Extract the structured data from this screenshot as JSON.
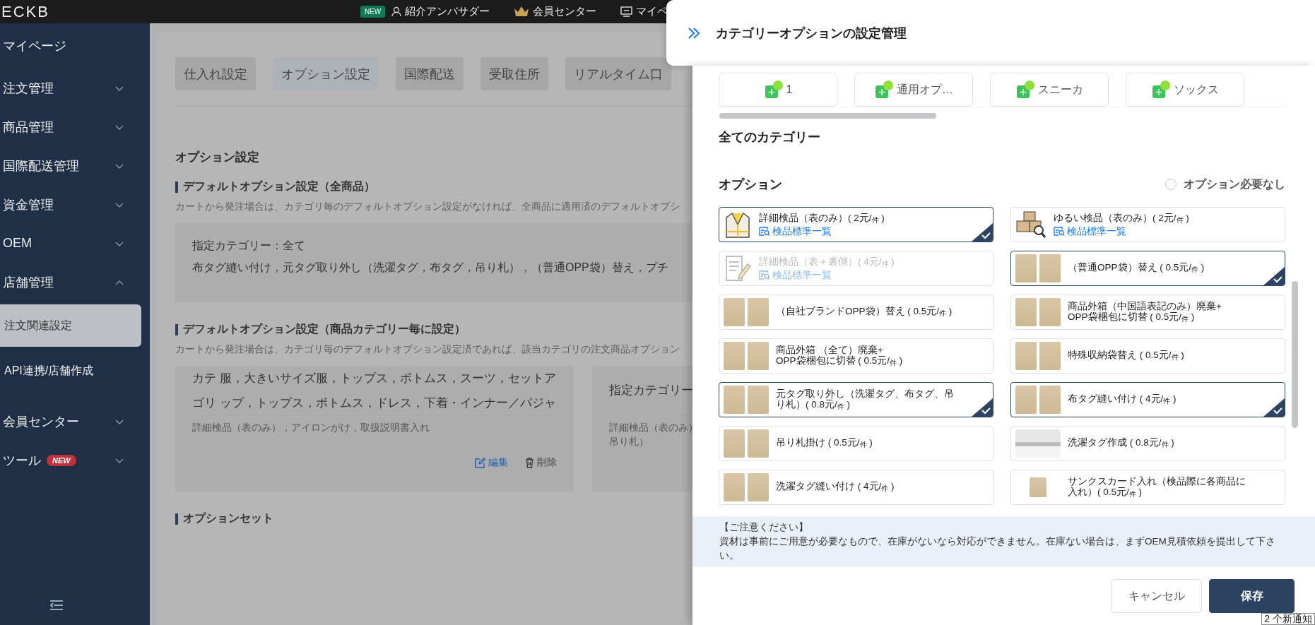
{
  "top_bar": {
    "logo": "ECKB",
    "links": [
      {
        "kind": "person",
        "badge": "NEW",
        "label": "紹介アンバサダー"
      },
      {
        "kind": "crown",
        "label": "会員センター"
      },
      {
        "kind": "monitor",
        "label": "マイペ"
      }
    ]
  },
  "sidebar": {
    "items": [
      {
        "label": "マイページ"
      },
      {
        "label": "注文管理",
        "expanded": false
      },
      {
        "label": "商品管理",
        "expanded": false
      },
      {
        "label": "国際配送管理",
        "expanded": false
      },
      {
        "label": "資金管理",
        "expanded": false
      },
      {
        "label": "OEM",
        "expanded": false
      },
      {
        "label": "店舗管理",
        "expanded": true,
        "children": [
          {
            "label": "注文関連設定",
            "selected": true
          },
          {
            "label": "API連携/店舗作成",
            "selected": false
          }
        ]
      },
      {
        "label": "会員センター",
        "expanded": false
      },
      {
        "label": "ツール",
        "badge": "NEW",
        "expanded": false
      }
    ]
  },
  "main": {
    "tabs": [
      {
        "label": "仕入れ設定",
        "selected": false
      },
      {
        "label": "オプション設定",
        "selected": true
      },
      {
        "label": "国際配送",
        "selected": false
      },
      {
        "label": "受取住所",
        "selected": false
      },
      {
        "label": "リアルタイム口",
        "selected": false
      }
    ],
    "title": "オプション設定",
    "sections": [
      {
        "heading": "デフォルトオプション設定（全商品）",
        "description": "カートから発注場合は、カテゴリ毎のデフォルトオプション設定がなければ、全商品に適用済のデフォルトオプシ",
        "cards": [
          {
            "category_lines": [
              "指定カテゴリー：全て"
            ],
            "option_lines": [
              "布タグ縫い付け，元タグ取り外し（洗濯タグ，布タグ，吊り札），（普通OPP袋）替え，プチ"
            ]
          }
        ]
      },
      {
        "heading": "デフォルトオプション設定（商品カテゴリー毎に設定）",
        "description": "カートから発注場合は、カテゴリ毎のデフォルトオプション設定済であれば、該当カテゴリの注文商品オプション",
        "cards": [
          {
            "category_lines": [
              "カテ 服，大きいサイズ服，トップス，ボトムス，スーツ，セットア",
              "ゴリ ップ，トップス，ボトムス，ドレス，下着・インナー／パジャ"
            ],
            "option_lines": [
              "詳細検品（表のみ），アイロンがけ，取扱説明書入れ"
            ],
            "actions": [
              {
                "kind": "edit",
                "label": "編集"
              },
              {
                "kind": "delete",
                "label": "削除"
              }
            ]
          },
          {
            "category_lines": [
              "指定カテゴリー"
            ],
            "option_lines": [
              "詳細検品（表のみ）",
              "吊り札）"
            ]
          }
        ]
      },
      {
        "heading": "オプションセット"
      }
    ]
  },
  "drawer": {
    "title": "カテゴリーオプションの設定管理",
    "chips": [
      {
        "label": "1"
      },
      {
        "label": "通用オプ…"
      },
      {
        "label": "スニーカ"
      },
      {
        "label": "ソックス"
      }
    ],
    "all_categories": "全てのカテゴリー",
    "options_heading": "オプション",
    "no_option": {
      "label": "オプション必要なし",
      "checked": false
    },
    "options": [
      {
        "kind": "jacket",
        "name": "詳細検品（表のみ）( 2元/$_{件}$ )",
        "link": "検品標準一覧",
        "selected": true,
        "disabled": false
      },
      {
        "kind": "boxes",
        "name": "ゆるい検品（表のみ）( 2元/$_{件}$ )",
        "link": "検品標準一覧",
        "selected": false,
        "disabled": false
      },
      {
        "kind": "document",
        "name": "詳細検品（表＋裏側）( 4元/$_{件}$ )",
        "link": "検品標準一覧",
        "selected": false,
        "disabled": true
      },
      {
        "kind": "photo-pair",
        "name": "（普通OPP袋）替え ( 0.5元/$_{件}$ )",
        "selected": true,
        "disabled": false
      },
      {
        "kind": "photo-pair",
        "name": "（自社ブランドOPP袋）替え ( 0.5元/$_{件}$ )",
        "selected": false,
        "disabled": false
      },
      {
        "kind": "photo-pair",
        "name": "商品外箱（中国語表記のみ）廃棄+\nOPP袋梱包に切替 ( 0.5元/$_{件}$ )",
        "selected": false,
        "disabled": false
      },
      {
        "kind": "photo-pair",
        "name": "商品外箱 （全て）廃棄+\nOPP袋梱包に切替 ( 0.5元/$_{件}$ )",
        "selected": false,
        "disabled": false
      },
      {
        "kind": "photo-pair",
        "name": "特殊収納袋替え ( 0.5元/$_{件}$ )",
        "selected": false,
        "disabled": false
      },
      {
        "kind": "photo-pair",
        "name": "元タグ取り外し（洗濯タグ、布タグ、吊り札）( 0.8元/$_{件}$ )",
        "selected": true,
        "disabled": false
      },
      {
        "kind": "photo-pair",
        "name": "布タグ縫い付け ( 4元/$_{件}$ )",
        "selected": true,
        "disabled": false
      },
      {
        "kind": "photo-pair",
        "name": "吊り札掛け ( 0.5元/$_{件}$ )",
        "selected": false,
        "disabled": false
      },
      {
        "kind": "photo-wide",
        "name": "洗濯タグ作成 ( 0.8元/$_{件}$ )",
        "selected": false,
        "disabled": false
      },
      {
        "kind": "photo-pair",
        "name": "洗濯タグ縫い付け ( 4元/$_{件}$ )",
        "selected": false,
        "disabled": false
      },
      {
        "kind": "photo-single",
        "name": "サンクスカード入れ（検品際に各商品に入れ）( 0.5元/$_{件}$ )",
        "selected": false,
        "disabled": false
      }
    ],
    "notice": {
      "title": "【ご注意ください】",
      "body": "資材は事前にご用意が必要なもので、在庫がないなら対応ができません。在庫ない場合は、まずOEM見積依頼を提出して下さい。"
    },
    "buttons": [
      {
        "kind": "secondary",
        "label": "キャンセル"
      },
      {
        "kind": "primary",
        "label": "保存"
      }
    ],
    "toast": "2 个新通知"
  }
}
